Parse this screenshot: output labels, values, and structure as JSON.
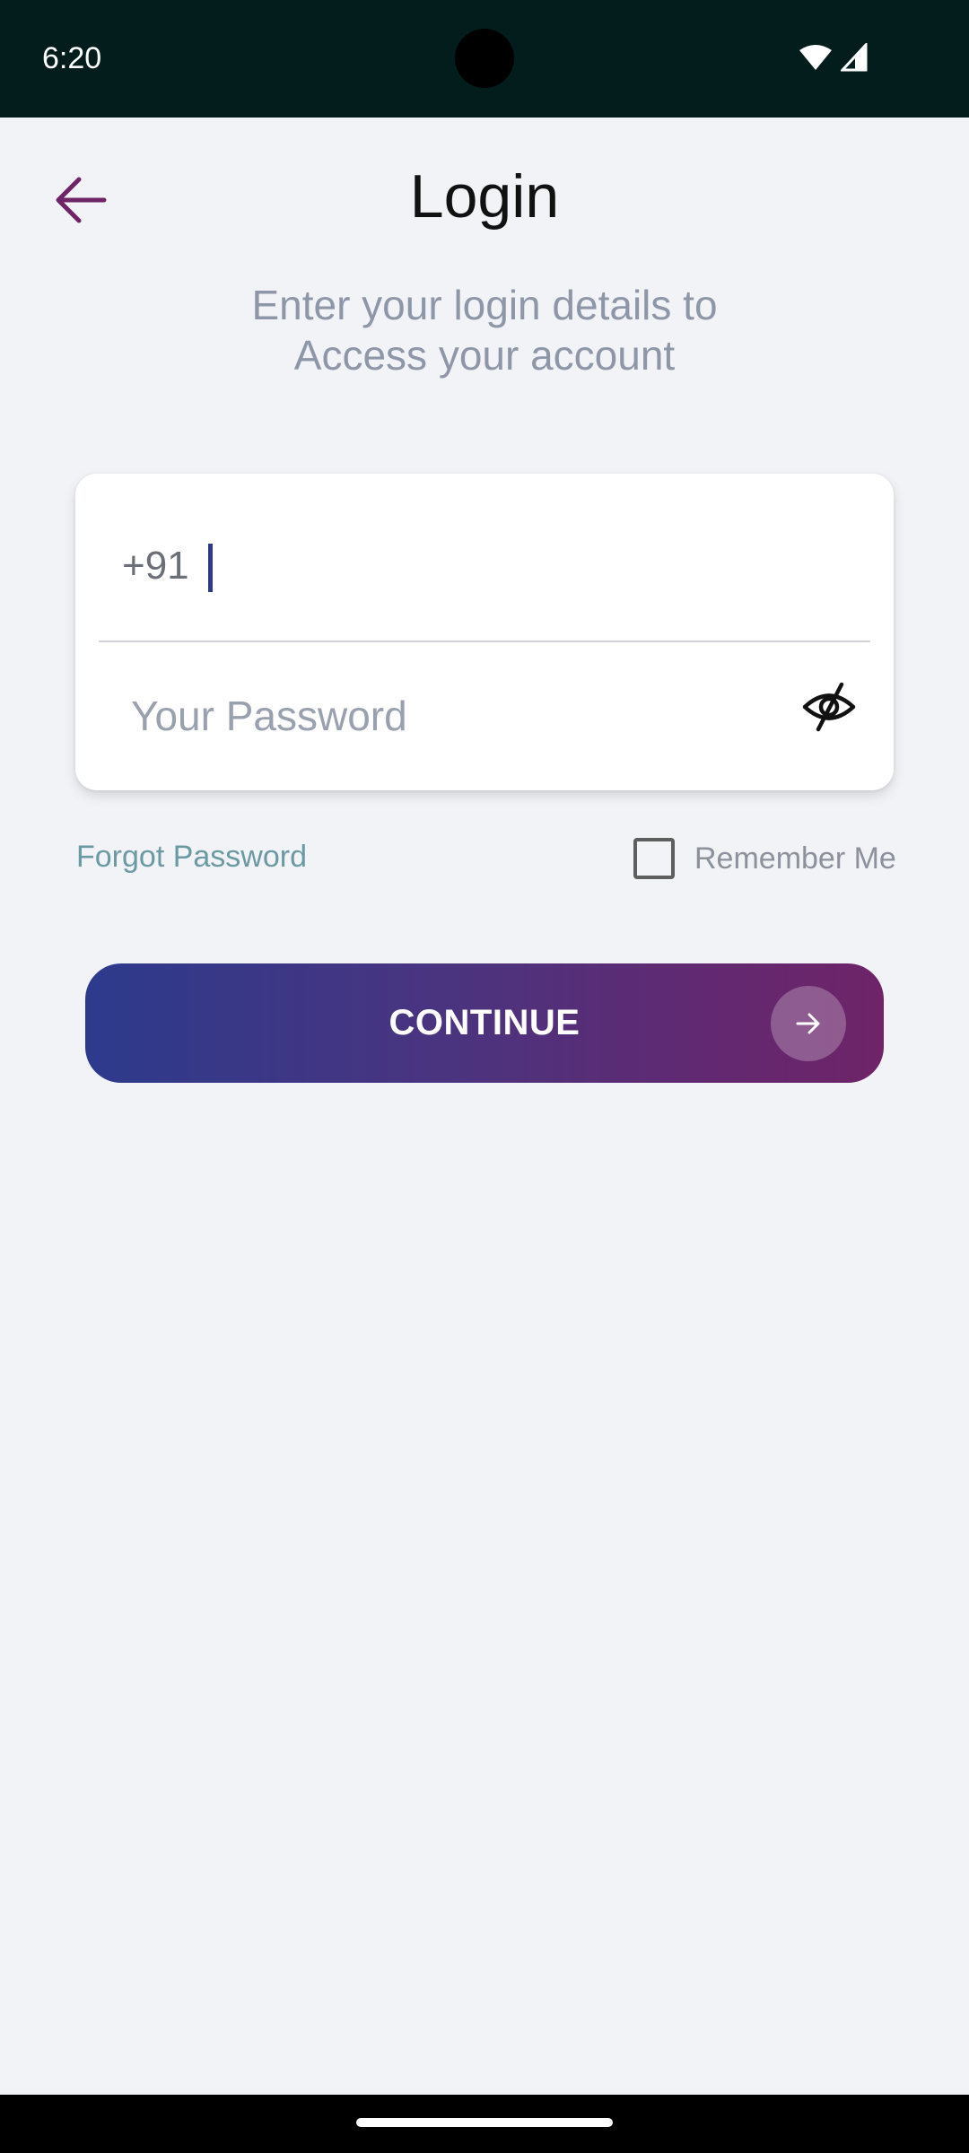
{
  "status_bar": {
    "time": "6:20",
    "icons": [
      "wifi-icon",
      "signal-icon"
    ]
  },
  "header": {
    "title": "Login",
    "back_icon": "arrow-left-icon"
  },
  "subtitle_line1": "Enter your login details to",
  "subtitle_line2": "Access your account",
  "form": {
    "country_code": "+91",
    "phone_value": "",
    "password_placeholder": "Your Password",
    "password_value": "",
    "visibility_icon": "eye-off-icon"
  },
  "options": {
    "forgot_password": "Forgot Password",
    "remember_me": "Remember Me",
    "remember_checked": false
  },
  "continue_button": {
    "label": "CONTINUE",
    "icon": "arrow-right-icon"
  },
  "colors": {
    "background": "#f2f3f7",
    "status_bar": "#021d1c",
    "accent_purple": "#6e2467",
    "accent_blue": "#2d3a8c",
    "link": "#6b9aa3"
  }
}
